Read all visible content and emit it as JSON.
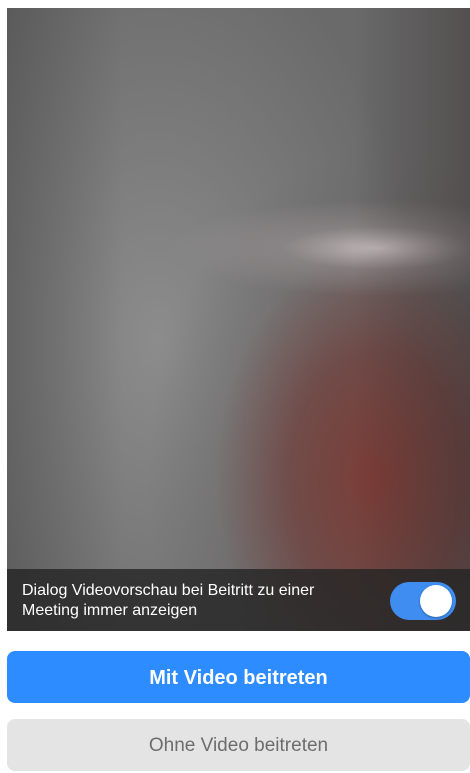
{
  "preview": {
    "always_show_label": "Dialog Videovorschau bei Beitritt zu einer Meeting immer anzeigen",
    "toggle_state": "on"
  },
  "buttons": {
    "join_with_video": "Mit Video beitreten",
    "join_without_video": "Ohne Video beitreten"
  },
  "colors": {
    "primary": "#2d8cff",
    "toggle_on": "#3f8df0",
    "secondary_bg": "#e4e4e4",
    "secondary_text": "#6d6d6d"
  }
}
